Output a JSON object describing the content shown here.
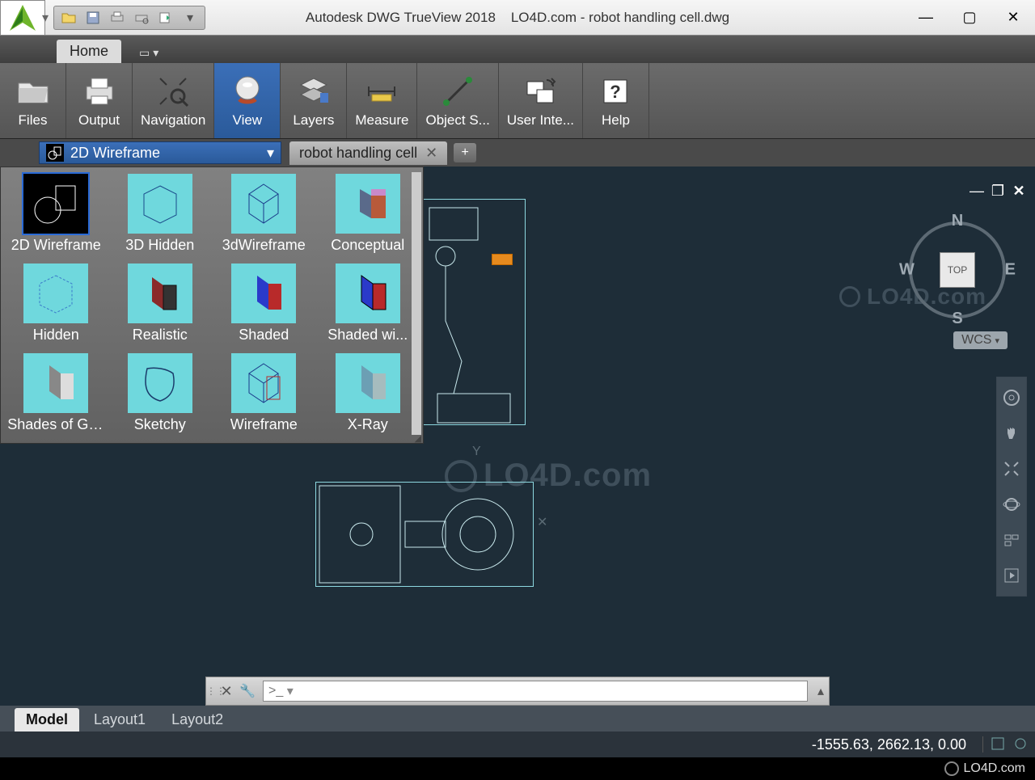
{
  "title_bar": {
    "app_title": "Autodesk DWG TrueView 2018",
    "doc_title": "LO4D.com - robot handling cell.dwg"
  },
  "tabs": {
    "home": "Home"
  },
  "ribbon": {
    "files": "Files",
    "output": "Output",
    "navigation": "Navigation",
    "view": "View",
    "layers": "Layers",
    "measure": "Measure",
    "object_snap": "Object S...",
    "user_interface": "User Inte...",
    "help": "Help"
  },
  "style_dropdown": {
    "value": "2D Wireframe"
  },
  "sheet_tab": {
    "name": "robot handling cell"
  },
  "visual_styles": [
    "2D Wireframe",
    "3D Hidden",
    "3dWireframe",
    "Conceptual",
    "Hidden",
    "Realistic",
    "Shaded",
    "Shaded wi...",
    "Shades of Gray",
    "Sketchy",
    "Wireframe",
    "X-Ray"
  ],
  "viewcube": {
    "face": "TOP",
    "n": "N",
    "s": "S",
    "e": "E",
    "w": "W",
    "wcs": "WCS"
  },
  "watermark": "LO4D.com",
  "command_line": {
    "prompt": ">_"
  },
  "layout_tabs": [
    "Model",
    "Layout1",
    "Layout2"
  ],
  "status": {
    "coords": "-1555.63, 2662.13, 0.00"
  },
  "brand": "LO4D.com"
}
